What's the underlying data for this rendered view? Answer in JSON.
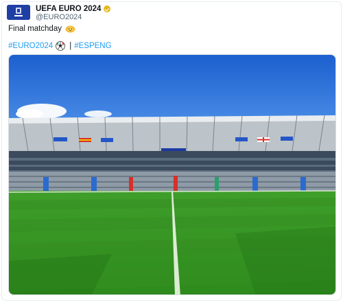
{
  "tweet": {
    "display_name": "UEFA EURO 2024",
    "handle": "@EURO2024",
    "text": "Final matchday",
    "hashtags": [
      "#EURO2024",
      "#ESPENG"
    ],
    "separator": "|"
  },
  "icons": {
    "verified": "verified-badge-icon",
    "trophy": "trophy-emoji-icon",
    "ball": "soccer-ball-emoji-icon",
    "avatar": "euro2024-logo"
  },
  "colors": {
    "hashtag": "#1d9bf0",
    "verified": "#e2b719",
    "avatar_bg": "#1f3fa4"
  },
  "media": {
    "alt": "stadium-photo"
  }
}
